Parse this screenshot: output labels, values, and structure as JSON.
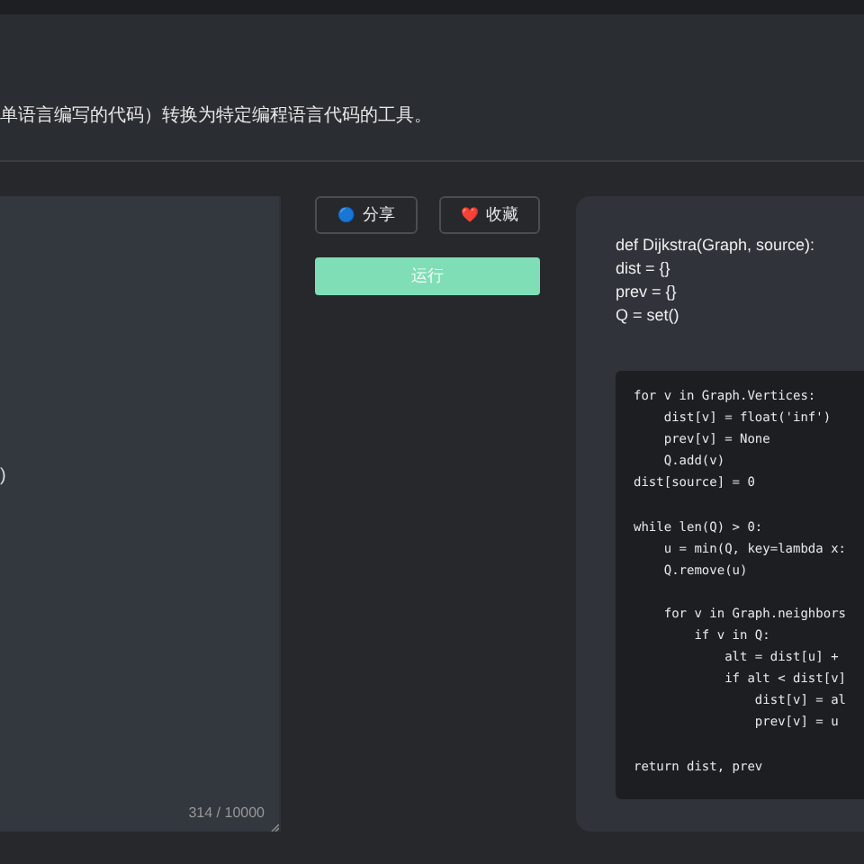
{
  "header": {
    "description": "单语言编写的代码）转换为特定编程语言代码的工具。"
  },
  "editor": {
    "value": ")",
    "counter": "314 / 10000"
  },
  "actions": {
    "share": {
      "icon": "🔵",
      "label": "分享"
    },
    "favorite": {
      "icon": "❤️",
      "label": "收藏"
    },
    "run": {
      "label": "运行"
    }
  },
  "output": {
    "intro_lines": [
      "def Dijkstra(Graph, source):",
      "dist = {}",
      "prev = {}",
      "Q = set()"
    ],
    "code_paragraphs": [
      [
        "for v in Graph.Vertices:",
        "    dist[v] = float('inf')",
        "    prev[v] = None",
        "    Q.add(v)",
        "dist[source] = 0"
      ],
      [
        "while len(Q) > 0:",
        "    u = min(Q, key=lambda x:",
        "    Q.remove(u)"
      ],
      [
        "    for v in Graph.neighbors",
        "        if v in Q:",
        "            alt = dist[u] +",
        "            if alt < dist[v]",
        "                dist[v] = al",
        "                prev[v] = u"
      ],
      [
        "return dist, prev"
      ]
    ]
  }
}
